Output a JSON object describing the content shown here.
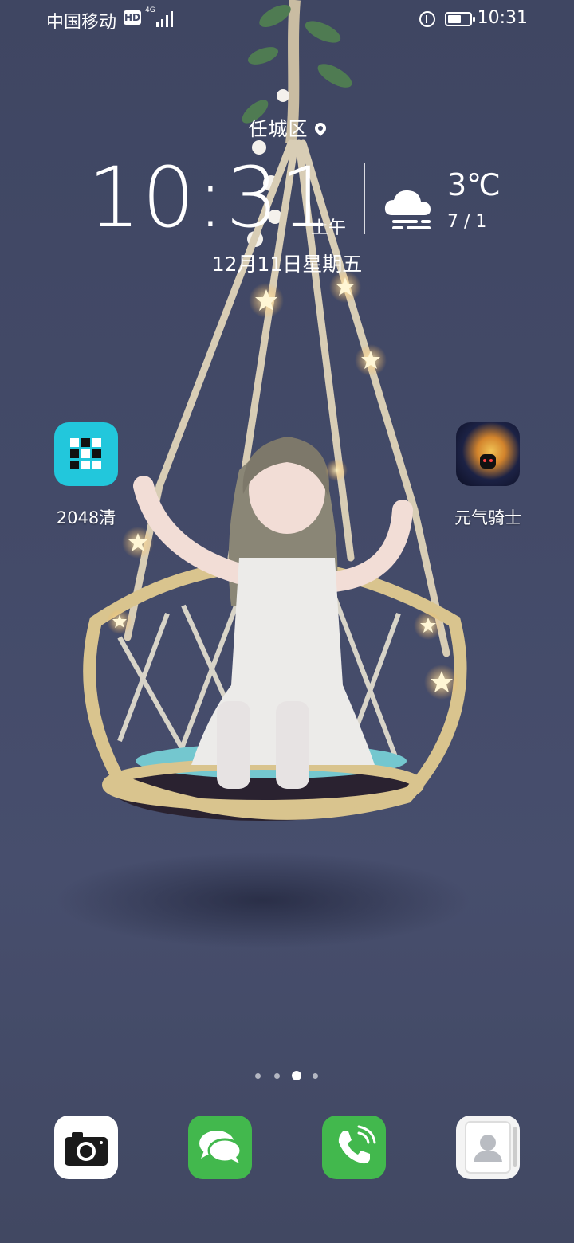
{
  "status_bar": {
    "carrier": "中国移动",
    "hd_badge": "HD",
    "network": "4G",
    "time": "10:31",
    "battery_level": 0.6
  },
  "clock_widget": {
    "location": "任城区",
    "time": "10:31",
    "ampm": "上午",
    "temperature": "3℃",
    "temp_range": "7 / 1",
    "date": "12月11日星期五",
    "weather_icon": "cloud-fog-icon"
  },
  "apps": [
    {
      "label": "2048清",
      "icon": "2048-grid-icon",
      "color": "#22c7dc"
    },
    {
      "label": "元气骑士",
      "icon": "soul-knight-icon",
      "color": "#1c2245"
    }
  ],
  "pager": {
    "count": 4,
    "active_index": 2
  },
  "dock": [
    {
      "name": "camera",
      "icon": "camera-icon"
    },
    {
      "name": "messages",
      "icon": "chat-bubbles-icon"
    },
    {
      "name": "phone",
      "icon": "phone-icon"
    },
    {
      "name": "contacts",
      "icon": "contact-icon"
    }
  ],
  "colors": {
    "background": "#434a68",
    "green": "#42b84d",
    "cyan": "#22c7dc"
  }
}
